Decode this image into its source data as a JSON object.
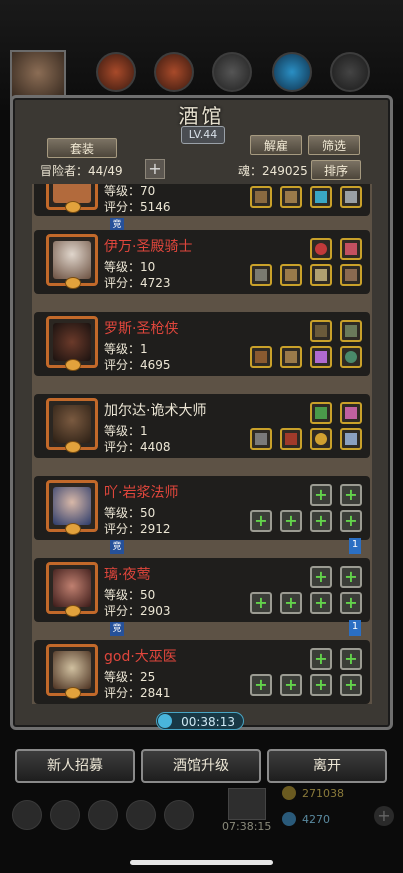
{
  "header": {
    "title": "酒馆",
    "level": "LV.44",
    "outfit_button": "套装",
    "dismiss_button": "解雇",
    "filter_button": "筛选",
    "sort_button": "排序",
    "adventurer_label": "冒险者：44/49",
    "add_symbol": "+",
    "soul_label": "魂：249025"
  },
  "heroes": [
    {
      "name": "",
      "level": "等级：70",
      "score": "评分：5146",
      "name_color": "red",
      "tag": "竞",
      "stars": ""
    },
    {
      "name": "伊万·圣殿骑士",
      "level": "等级：10",
      "score": "评分：4723",
      "name_color": "red",
      "tag": "",
      "stars": ""
    },
    {
      "name": "罗斯·圣枪侠",
      "level": "等级：1",
      "score": "评分：4695",
      "name_color": "red",
      "tag": "",
      "stars": ""
    },
    {
      "name": "加尔达·诡术大师",
      "level": "等级：1",
      "score": "评分：4408",
      "name_color": "white",
      "tag": "",
      "stars": ""
    },
    {
      "name": "吖·岩浆法师",
      "level": "等级：50",
      "score": "评分：2912",
      "name_color": "red",
      "tag": "竞",
      "stars": "1"
    },
    {
      "name": "璃·夜莺",
      "level": "等级：50",
      "score": "评分：2903",
      "name_color": "red",
      "tag": "竞",
      "stars": "1"
    },
    {
      "name": "god·大巫医",
      "level": "等级：25",
      "score": "评分：2841",
      "name_color": "red",
      "tag": "",
      "stars": ""
    }
  ],
  "timer": "00:38:13",
  "bottom_buttons": {
    "recruit": "新人招募",
    "upgrade": "酒馆升级",
    "leave": "离开"
  },
  "background_hud": {
    "timer2": "07:38:15",
    "gold": "271038",
    "gems": "4270",
    "plus": "+"
  },
  "colors": {
    "panel": "#3b3833",
    "name_red": "#e0463c",
    "avatar_border": "#c2692a",
    "slot_gold": "#c9a12a",
    "plus_green": "#63d34b"
  }
}
